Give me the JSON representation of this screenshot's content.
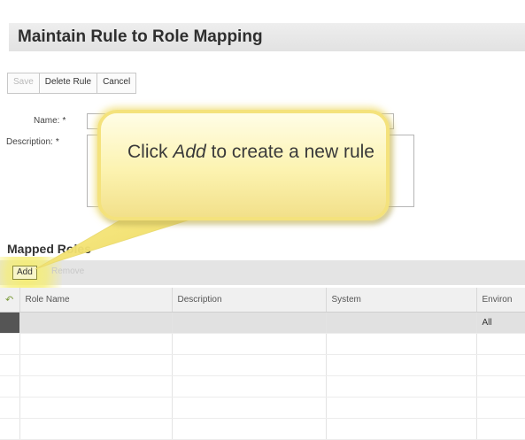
{
  "page": {
    "title": "Maintain Rule to Role Mapping"
  },
  "toolbar": {
    "save_label": "Save",
    "delete_label": "Delete Rule",
    "cancel_label": "Cancel"
  },
  "form": {
    "name_label": "Name:",
    "description_label": "Description:",
    "required_marker": "*",
    "name_value": "",
    "description_value": ""
  },
  "callout": {
    "prefix": "Click ",
    "emphasis": "Add",
    "suffix": " to create a new rule"
  },
  "mapped_roles": {
    "title": "Mapped Roles",
    "add_label": "Add",
    "remove_label": "Remove",
    "columns": [
      "Role Name",
      "Description",
      "System",
      "Environ"
    ],
    "rows": [
      {
        "role": "",
        "description": "",
        "system": "",
        "environment": "All"
      }
    ]
  },
  "colors": {
    "callout": "#fcf3b0",
    "highlight": "#f6ee6e",
    "toolbar": "#e4e4e4"
  }
}
